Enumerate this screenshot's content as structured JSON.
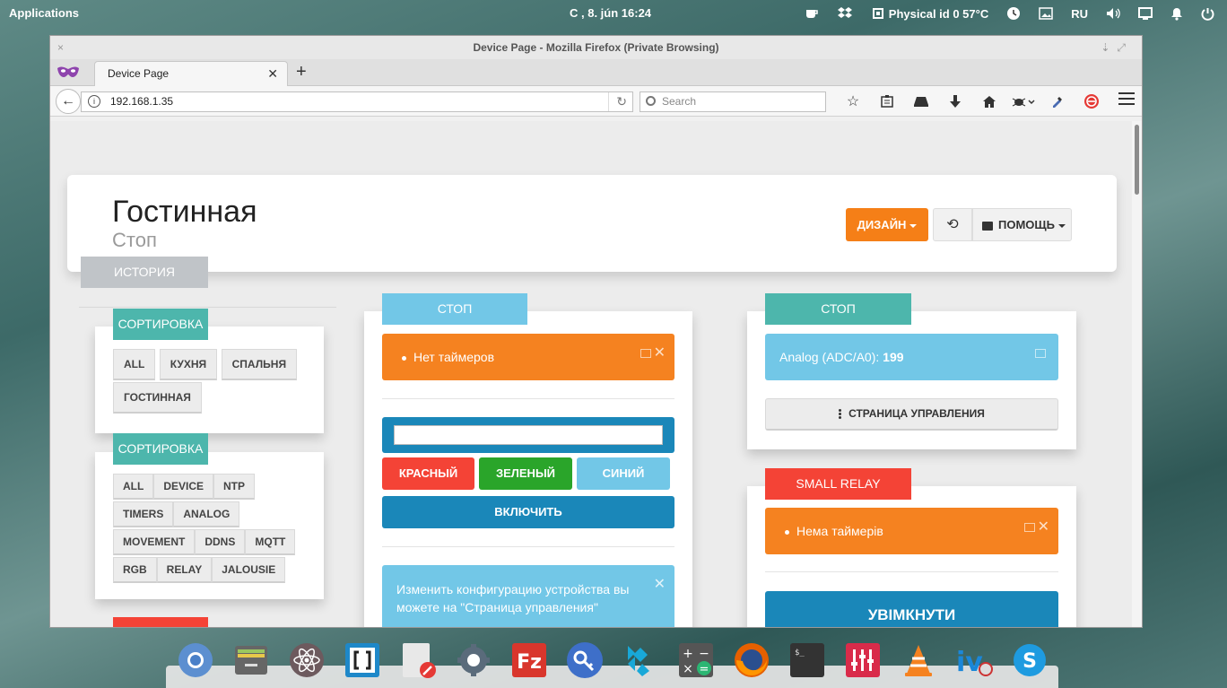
{
  "system_panel": {
    "applications": "Applications",
    "clock": "C , 8. jún     16:24",
    "sensor": "Physical id 0 57°C",
    "keyboard_layout": "RU"
  },
  "browser": {
    "window_title": "Device Page - Mozilla Firefox (Private Browsing)",
    "tab_title": "Device Page",
    "url": "192.168.1.35",
    "search_placeholder": "Search"
  },
  "page": {
    "title": "Гостинная",
    "subtitle": "Стоп",
    "design_button": "ДИЗАЙН",
    "help_button": "ПОМОЩЬ",
    "history_tab": "ИСТОРИЯ",
    "sort_panel_1": {
      "tag": "СОРТИРОВКА",
      "chips": [
        "ALL",
        "КУХНЯ",
        "СПАЛЬНЯ",
        "ГОСТИННАЯ"
      ]
    },
    "sort_panel_2": {
      "tag": "СОРТИРОВКА",
      "chips": [
        "ALL",
        "DEVICE",
        "NTP",
        "TIMERS",
        "ANALOG",
        "MOVEMENT",
        "DDNS",
        "MQTT",
        "RGB",
        "RELAY",
        "JALOUSIE"
      ]
    },
    "middle_panel": {
      "tag": "СТОП",
      "timers": "Нет таймеров",
      "btn_red": "КРАСНЫЙ",
      "btn_green": "ЗЕЛЕНЫЙ",
      "btn_blue": "СИНИЙ",
      "btn_on": "ВКЛЮЧИТЬ",
      "info": "Изменить конфигурацию устройства вы можете на \"Страница управления\""
    },
    "right_panel_1": {
      "tag": "СТОП",
      "analog_label": "Analog (ADC/A0):",
      "analog_value": "199",
      "control_page_button": "СТРАНИЦА УПРАВЛЕНИЯ"
    },
    "right_panel_2": {
      "tag": "SMALL RELAY",
      "timers": "Нема таймерів",
      "on_button": "УВІМКНУТИ"
    }
  },
  "colors": {
    "teal": "#4db6ac",
    "sky": "#72c7e7",
    "orange": "#f58220",
    "red": "#f44336",
    "green": "#2aa52a",
    "blue_dark": "#1a87b9",
    "grey_tag": "#c0c4c8"
  },
  "dock_icons": [
    "chromium-icon",
    "files-icon",
    "atom-icon",
    "brackets-icon",
    "text-editor-icon",
    "settings-icon",
    "filezilla-icon",
    "keys-icon",
    "kodi-icon",
    "calculator-icon",
    "firefox-icon",
    "terminal-icon",
    "mixer-icon",
    "vlc-icon",
    "ivy-icon",
    "skype-icon"
  ]
}
